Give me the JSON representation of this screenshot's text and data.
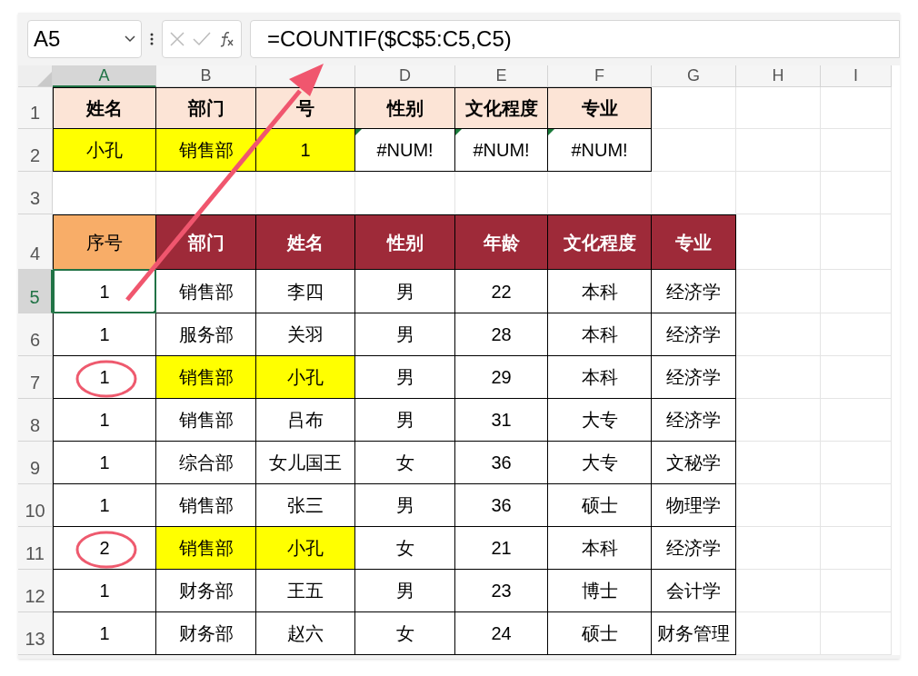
{
  "name_box": {
    "value": "A5"
  },
  "formula_bar": {
    "value": "=COUNTIF($C$5:C5,C5)"
  },
  "columns": [
    {
      "label": "A",
      "selected": true
    },
    {
      "label": "B",
      "selected": false
    },
    {
      "selected": false
    },
    {
      "label": "D",
      "selected": false
    },
    {
      "label": "E",
      "selected": false
    },
    {
      "label": "F",
      "selected": false
    },
    {
      "label": "G",
      "selected": false
    },
    {
      "label": "H",
      "selected": false
    },
    {
      "label": "I",
      "selected": false
    }
  ],
  "rows": [
    {
      "number": "1",
      "selected": false,
      "cells": [
        {
          "text": "姓名",
          "kind": "header",
          "color": "#fce4d6"
        },
        {
          "text": "部门",
          "kind": "header",
          "color": "#fce4d6"
        },
        {
          "text": "号",
          "kind": "header",
          "color": "#fce4d6"
        },
        {
          "text": "性别",
          "kind": "header",
          "color": "#fce4d6"
        },
        {
          "text": "文化程度",
          "kind": "header",
          "color": "#fce4d6"
        },
        {
          "text": "专业",
          "kind": "header",
          "color": "#fce4d6"
        }
      ]
    },
    {
      "number": "2",
      "selected": false,
      "cells": [
        {
          "text": "小孔",
          "kind": "data",
          "color": "#ffff00"
        },
        {
          "text": "销售部",
          "kind": "data",
          "color": "#ffff00"
        },
        {
          "text": "1",
          "kind": "data",
          "color": "#ffff00"
        },
        {
          "text": "#NUM!",
          "kind": "data",
          "error_flag": true
        },
        {
          "text": "#NUM!",
          "kind": "data",
          "error_flag": true
        },
        {
          "text": "#NUM!",
          "kind": "data",
          "error_flag": true
        }
      ]
    },
    {
      "number": "3",
      "selected": false,
      "cells": []
    },
    {
      "number": "4",
      "selected": false,
      "cells": [
        {
          "text": "序号",
          "kind": "data",
          "color": "#f8ad68"
        },
        {
          "text": "部门",
          "kind": "header",
          "color": "#9e2a39"
        },
        {
          "text": "姓名",
          "kind": "header",
          "color": "#9e2a39"
        },
        {
          "text": "性别",
          "kind": "header",
          "color": "#9e2a39"
        },
        {
          "text": "年龄",
          "kind": "header",
          "color": "#9e2a39"
        },
        {
          "text": "文化程度",
          "kind": "header",
          "color": "#9e2a39"
        },
        {
          "text": "专业",
          "kind": "header",
          "color": "#9e2a39"
        }
      ]
    },
    {
      "number": "5",
      "selected": true,
      "cells": [
        {
          "text": "1",
          "kind": "data",
          "selected": true
        },
        {
          "text": "销售部",
          "kind": "data"
        },
        {
          "text": "李四",
          "kind": "data"
        },
        {
          "text": "男",
          "kind": "data"
        },
        {
          "text": "22",
          "kind": "data"
        },
        {
          "text": "本科",
          "kind": "data"
        },
        {
          "text": "经济学",
          "kind": "data"
        }
      ]
    },
    {
      "number": "6",
      "selected": false,
      "cells": [
        {
          "text": "1",
          "kind": "data"
        },
        {
          "text": "服务部",
          "kind": "data"
        },
        {
          "text": "关羽",
          "kind": "data"
        },
        {
          "text": "男",
          "kind": "data"
        },
        {
          "text": "28",
          "kind": "data"
        },
        {
          "text": "本科",
          "kind": "data"
        },
        {
          "text": "经济学",
          "kind": "data"
        }
      ]
    },
    {
      "number": "7",
      "selected": false,
      "cells": [
        {
          "text": "1",
          "kind": "data",
          "circled": true
        },
        {
          "text": "销售部",
          "kind": "data",
          "color": "#ffff00"
        },
        {
          "text": "小孔",
          "kind": "data",
          "color": "#ffff00"
        },
        {
          "text": "男",
          "kind": "data"
        },
        {
          "text": "29",
          "kind": "data"
        },
        {
          "text": "本科",
          "kind": "data"
        },
        {
          "text": "经济学",
          "kind": "data"
        }
      ]
    },
    {
      "number": "8",
      "selected": false,
      "cells": [
        {
          "text": "1",
          "kind": "data"
        },
        {
          "text": "销售部",
          "kind": "data"
        },
        {
          "text": "吕布",
          "kind": "data"
        },
        {
          "text": "男",
          "kind": "data"
        },
        {
          "text": "31",
          "kind": "data"
        },
        {
          "text": "大专",
          "kind": "data"
        },
        {
          "text": "经济学",
          "kind": "data"
        }
      ]
    },
    {
      "number": "9",
      "selected": false,
      "cells": [
        {
          "text": "1",
          "kind": "data"
        },
        {
          "text": "综合部",
          "kind": "data"
        },
        {
          "text": "女儿国王",
          "kind": "data"
        },
        {
          "text": "女",
          "kind": "data"
        },
        {
          "text": "36",
          "kind": "data"
        },
        {
          "text": "大专",
          "kind": "data"
        },
        {
          "text": "文秘学",
          "kind": "data"
        }
      ]
    },
    {
      "number": "10",
      "selected": false,
      "cells": [
        {
          "text": "1",
          "kind": "data"
        },
        {
          "text": "销售部",
          "kind": "data"
        },
        {
          "text": "张三",
          "kind": "data"
        },
        {
          "text": "男",
          "kind": "data"
        },
        {
          "text": "36",
          "kind": "data"
        },
        {
          "text": "硕士",
          "kind": "data"
        },
        {
          "text": "物理学",
          "kind": "data"
        }
      ]
    },
    {
      "number": "11",
      "selected": false,
      "cells": [
        {
          "text": "2",
          "kind": "data",
          "circled": true
        },
        {
          "text": "销售部",
          "kind": "data",
          "color": "#ffff00"
        },
        {
          "text": "小孔",
          "kind": "data",
          "color": "#ffff00"
        },
        {
          "text": "女",
          "kind": "data"
        },
        {
          "text": "21",
          "kind": "data"
        },
        {
          "text": "本科",
          "kind": "data"
        },
        {
          "text": "经济学",
          "kind": "data"
        }
      ]
    },
    {
      "number": "12",
      "selected": false,
      "cells": [
        {
          "text": "1",
          "kind": "data"
        },
        {
          "text": "财务部",
          "kind": "data"
        },
        {
          "text": "王五",
          "kind": "data"
        },
        {
          "text": "男",
          "kind": "data"
        },
        {
          "text": "23",
          "kind": "data"
        },
        {
          "text": "博士",
          "kind": "data"
        },
        {
          "text": "会计学",
          "kind": "data"
        }
      ]
    },
    {
      "number": "13",
      "selected": false,
      "cells": [
        {
          "text": "1",
          "kind": "data"
        },
        {
          "text": "财务部",
          "kind": "data"
        },
        {
          "text": "赵六",
          "kind": "data"
        },
        {
          "text": "女",
          "kind": "data"
        },
        {
          "text": "24",
          "kind": "data"
        },
        {
          "text": "硕士",
          "kind": "data"
        },
        {
          "text": "财务管理",
          "kind": "data"
        }
      ]
    }
  ]
}
